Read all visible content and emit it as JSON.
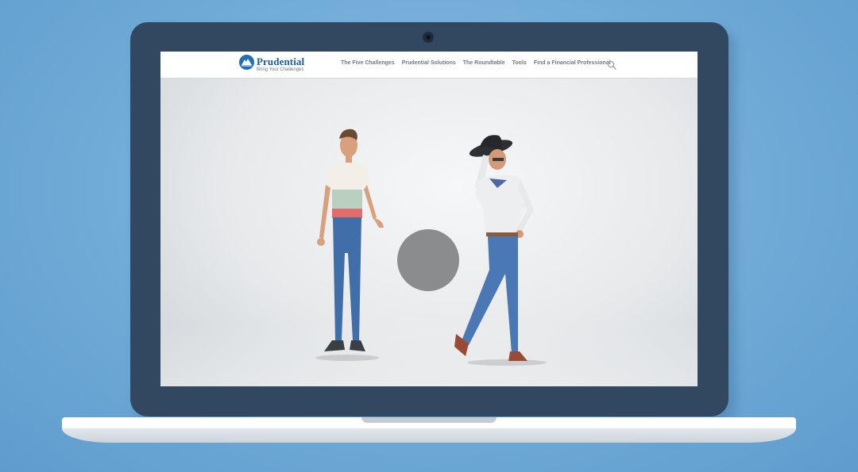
{
  "brand": {
    "name": "Prudential",
    "tagline": "Bring Your Challenges",
    "color": "#1c5c99",
    "logo_icon": "rock-of-gibraltar-logo"
  },
  "nav": {
    "items": [
      {
        "label": "The Five Challenges"
      },
      {
        "label": "Prudential Solutions"
      },
      {
        "label": "The Roundtable"
      },
      {
        "label": "Tools"
      },
      {
        "label": "Find a Financial Professional"
      }
    ],
    "search_icon": "search-icon"
  },
  "video": {
    "play_icon": "play-button",
    "characters": [
      "animated-young-man-figure",
      "animated-cowboy-figure"
    ]
  },
  "colors": {
    "background": "#6ea9d6",
    "bezel": "#324760",
    "accent": "#1f6fb5"
  }
}
